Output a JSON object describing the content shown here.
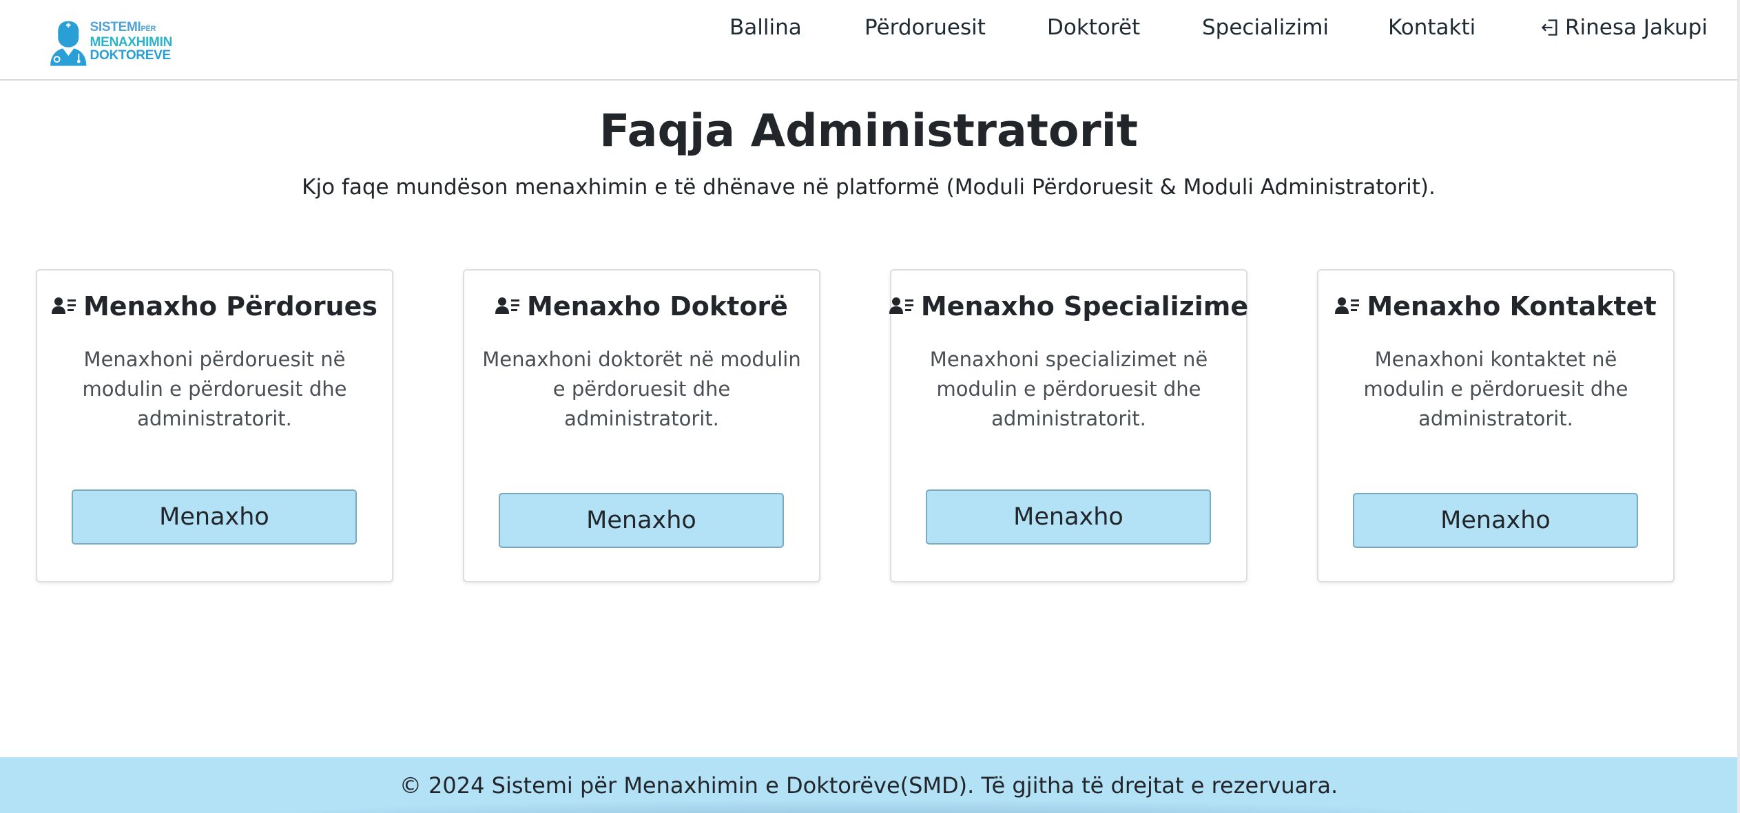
{
  "logo": {
    "line1": "SISTEMI",
    "line1_small": "PËR",
    "line2": "MENAXHIMIN",
    "line3": "DOKTOREVE",
    "colors": {
      "primary": "#2a9fd6",
      "teal": "#2bb3c9"
    }
  },
  "nav": {
    "items": [
      {
        "label": "Ballina"
      },
      {
        "label": "Përdoruesit"
      },
      {
        "label": "Doktorët"
      },
      {
        "label": "Specializimi"
      },
      {
        "label": "Kontakti"
      }
    ],
    "user": {
      "label": "Rinesa Jakupi",
      "icon": "logout-icon"
    }
  },
  "page": {
    "title": "Faqja Administratorit",
    "subtitle": "Kjo faqe mundëson menaxhimin e të dhënave në platformë (Moduli Përdoruesit & Moduli Administratorit)."
  },
  "cards": [
    {
      "title": "Menaxho Përdorues",
      "icon": "user-list-icon",
      "text": "Menaxhoni përdoruesit në modulin e përdoruesit dhe administratorit.",
      "button": "Menaxho"
    },
    {
      "title": "Menaxho Doktorë",
      "icon": "user-list-icon",
      "text": "Menaxhoni doktorët në modulin e përdoruesit dhe administratorit.",
      "button": "Menaxho"
    },
    {
      "title": "Menaxho Specializime",
      "icon": "user-list-icon",
      "text": "Menaxhoni specializimet në modulin e përdoruesit dhe administratorit.",
      "button": "Menaxho"
    },
    {
      "title": "Menaxho Kontaktet",
      "icon": "user-list-icon",
      "text": "Menaxhoni kontaktet në modulin e përdoruesit dhe administratorit.",
      "button": "Menaxho"
    }
  ],
  "footer": {
    "text": "© 2024 Sistemi për Menaxhimin e Doktorëve(SMD). Të gjitha të drejtat e rezervuara."
  },
  "colors": {
    "button_bg": "#b3e2f7",
    "footer_bg": "#b3e2f7",
    "text": "#212529"
  }
}
